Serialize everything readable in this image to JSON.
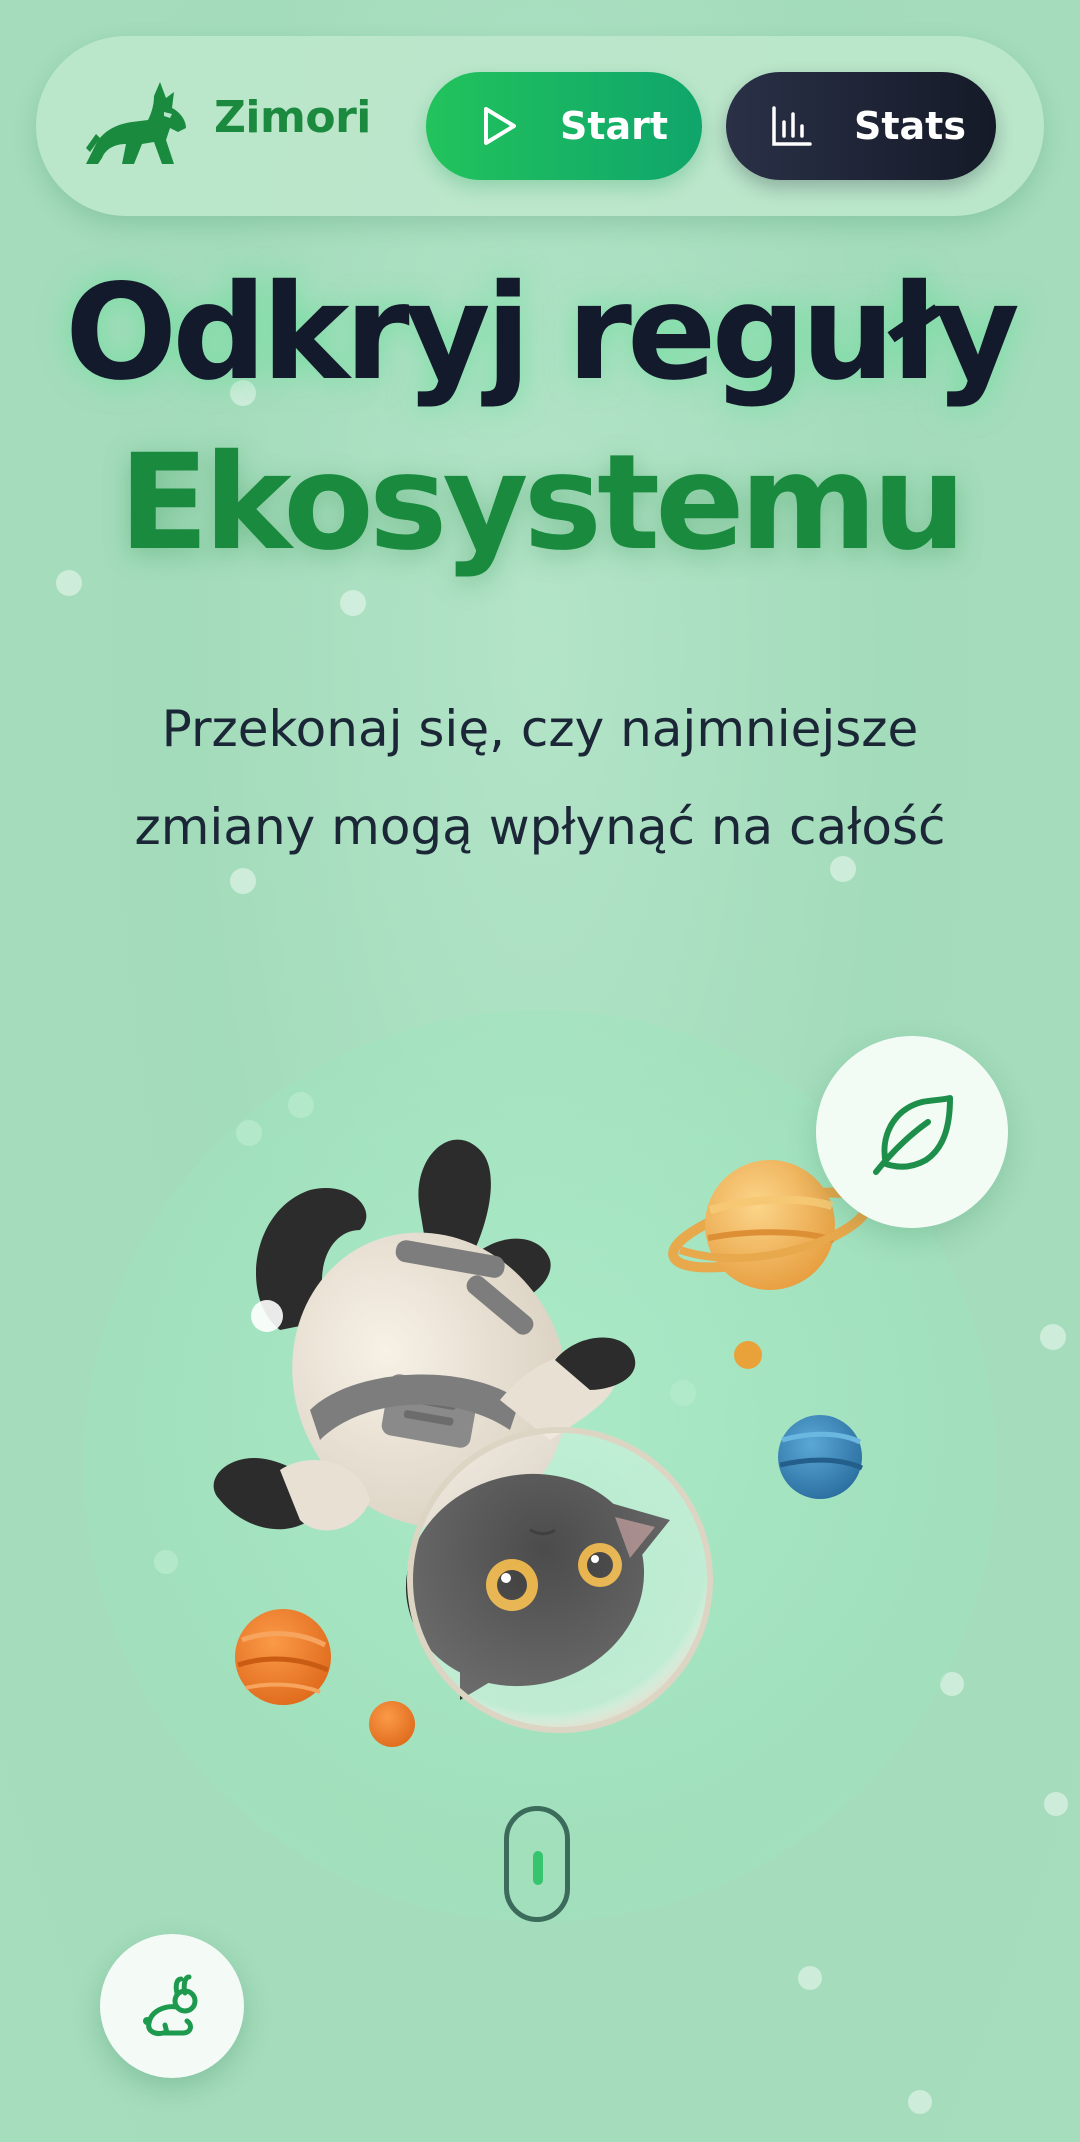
{
  "header": {
    "brand_name": "Zimori",
    "logo_icon": "lynx-icon",
    "start_button": {
      "label": "Start",
      "icon": "play-icon"
    },
    "stats_button": {
      "label": "Stats",
      "icon": "bar-chart-icon"
    }
  },
  "hero": {
    "title_line1": "Odkryj reguły",
    "title_line2": "Ekosystemu",
    "subtitle_line1": "Przekonaj się, czy najmniejsze",
    "subtitle_line2": "zmiany mogą wpłynąć na całość"
  },
  "illustration": {
    "subject": "astronaut-cat-illustration"
  },
  "badges": {
    "leaf_icon": "leaf-icon",
    "rabbit_icon": "rabbit-icon"
  },
  "colors": {
    "brand_green": "#1b8a3f",
    "start_gradient_start": "#22c35c",
    "start_gradient_end": "#0fa56b",
    "stats_bg": "#1a2030",
    "title_dark": "#121a2c",
    "background": "#a6ddbd"
  }
}
